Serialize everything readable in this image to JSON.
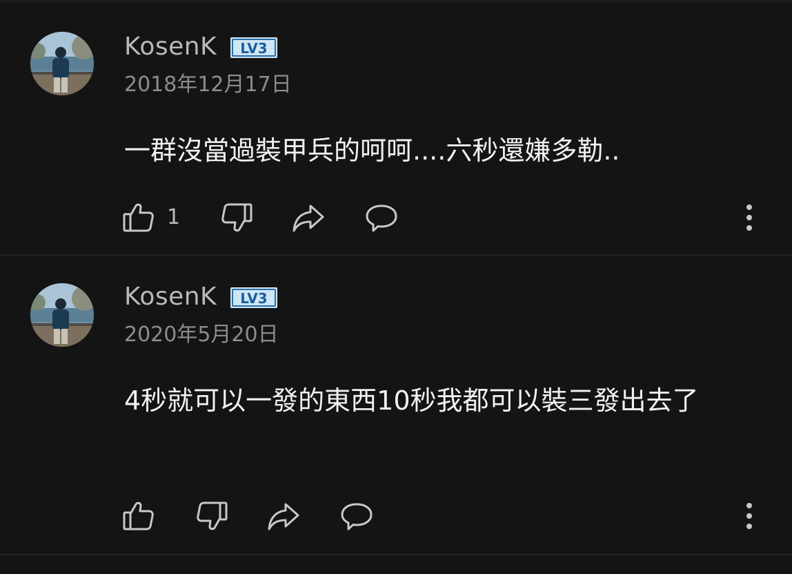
{
  "comments": [
    {
      "username": "KosenK",
      "level_badge": "LV3",
      "date": "2018年12月17日",
      "text": "一群沒當過裝甲兵的呵呵....六秒還嫌多勒..",
      "like_count": "1",
      "icons": [
        "thumbs-up-icon",
        "thumbs-down-icon",
        "share-icon",
        "reply-icon",
        "more-vertical-icon"
      ]
    },
    {
      "username": "KosenK",
      "level_badge": "LV3",
      "date": "2020年5月20日",
      "text": "4秒就可以一發的東西10秒我都可以裝三發出去了",
      "like_count": "",
      "icons": [
        "thumbs-up-icon",
        "thumbs-down-icon",
        "share-icon",
        "reply-icon",
        "more-vertical-icon"
      ]
    }
  ],
  "colors": {
    "background": "#141414",
    "badge_fill": "#cfe6f5",
    "badge_text": "#1a5f9e",
    "icon": "#c8c8c8"
  }
}
